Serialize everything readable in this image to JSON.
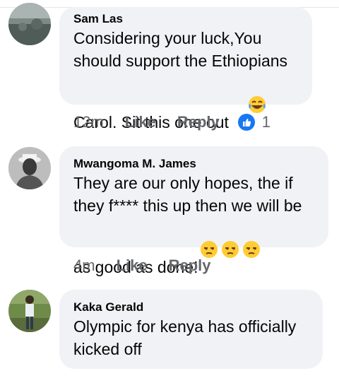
{
  "comments": [
    {
      "author": "Sam Las",
      "text": "Considering your luck,You\nshould support the Ethiopians\nCarol. Sit this one out",
      "emoji": "joy-emoji",
      "time": "12m",
      "like_label": "Like",
      "reply_label": "Reply",
      "reaction_icon": "like-reaction-icon",
      "reaction_count": "1"
    },
    {
      "author": "Mwangoma M. James",
      "text": "They are our only hopes, the if\nthey f**** this up then we will be\nas good as done!",
      "emoji": "unamused-emoji",
      "emoji_count": 3,
      "time": "4m",
      "like_label": "Like",
      "reply_label": "Reply"
    },
    {
      "author": "Kaka Gerald",
      "text": "Olympic for kenya has officially\nkicked off",
      "time": "",
      "like_label": "",
      "reply_label": ""
    }
  ],
  "colors": {
    "bubble": "#f0f2f5",
    "meta_text": "#65676b",
    "like_blue": "#1877f2"
  }
}
